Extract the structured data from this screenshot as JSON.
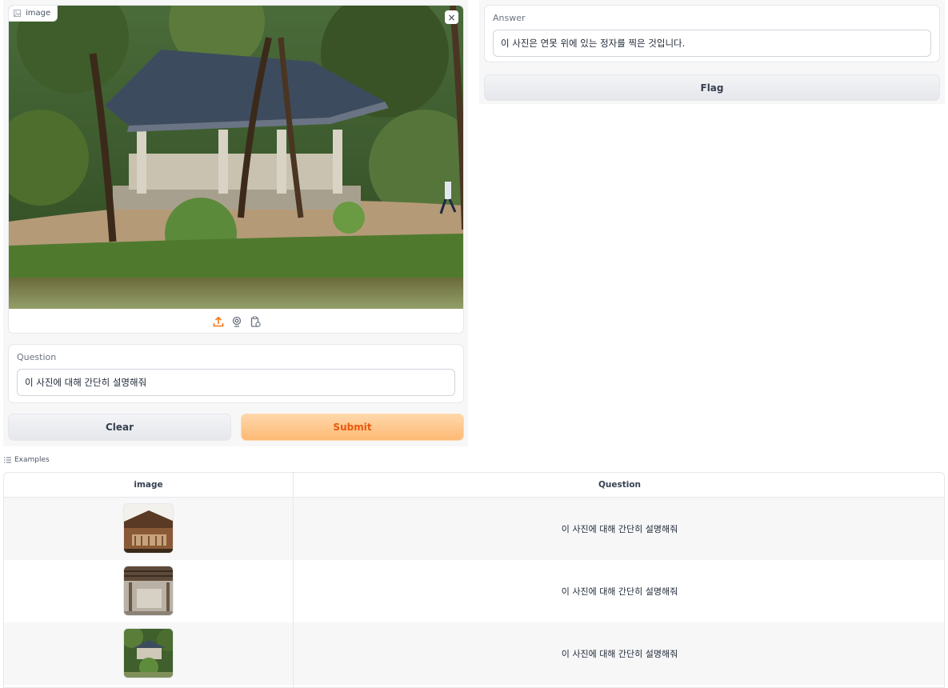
{
  "image_input": {
    "label": "image",
    "close_symbol": "×"
  },
  "question": {
    "label": "Question",
    "value": "이 사진에 대해 간단히 설명해줘"
  },
  "answer": {
    "label": "Answer",
    "value": "이 사진은 연못 위에 있는 정자를 찍은 것입니다."
  },
  "buttons": {
    "clear": "Clear",
    "submit": "Submit",
    "flag": "Flag"
  },
  "examples": {
    "label": "Examples",
    "headers": [
      "image",
      "Question"
    ],
    "rows": [
      {
        "question": "이 사진에 대해 간단히 설명해줘"
      },
      {
        "question": "이 사진에 대해 간단히 설명해줘"
      },
      {
        "question": "이 사진에 대해 간단히 설명해줘"
      }
    ]
  },
  "colors": {
    "accent": "#ea580c",
    "submit_bg": "#fdba74",
    "panel_bg": "#f7f7f8"
  }
}
